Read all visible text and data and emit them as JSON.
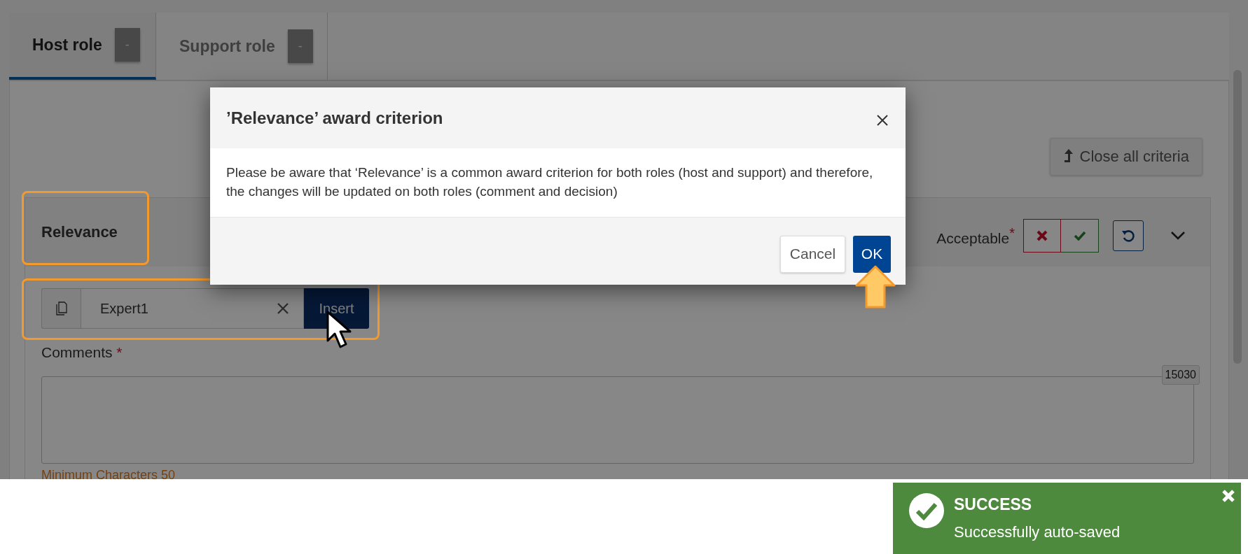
{
  "tabs": [
    {
      "label": "Host role",
      "badge": "-",
      "selected": true
    },
    {
      "label": "Support role",
      "badge": "-",
      "selected": false
    }
  ],
  "toolbar": {
    "close_all_button": "Close all criteria"
  },
  "criterion": {
    "title": "Relevance",
    "decision_label": "Acceptable",
    "required_mark": "*"
  },
  "template": {
    "value": "Expert1",
    "insert_button": "Insert"
  },
  "comments": {
    "label": "Comments",
    "required_mark": "*",
    "counter": "15030",
    "hint": "Minimum Characters 50"
  },
  "dialog": {
    "title": "’Relevance’ award criterion",
    "message": "Please be aware that ‘Relevance’ is a common award criterion for both roles (host and support) and therefore, the changes will be updated on both roles (comment and decision)",
    "buttons": [
      {
        "label": "Cancel",
        "kind": "secondary"
      },
      {
        "label": "OK",
        "kind": "primary"
      }
    ]
  },
  "toast": {
    "title": "SUCCESS",
    "message": "Successfully auto-saved"
  }
}
